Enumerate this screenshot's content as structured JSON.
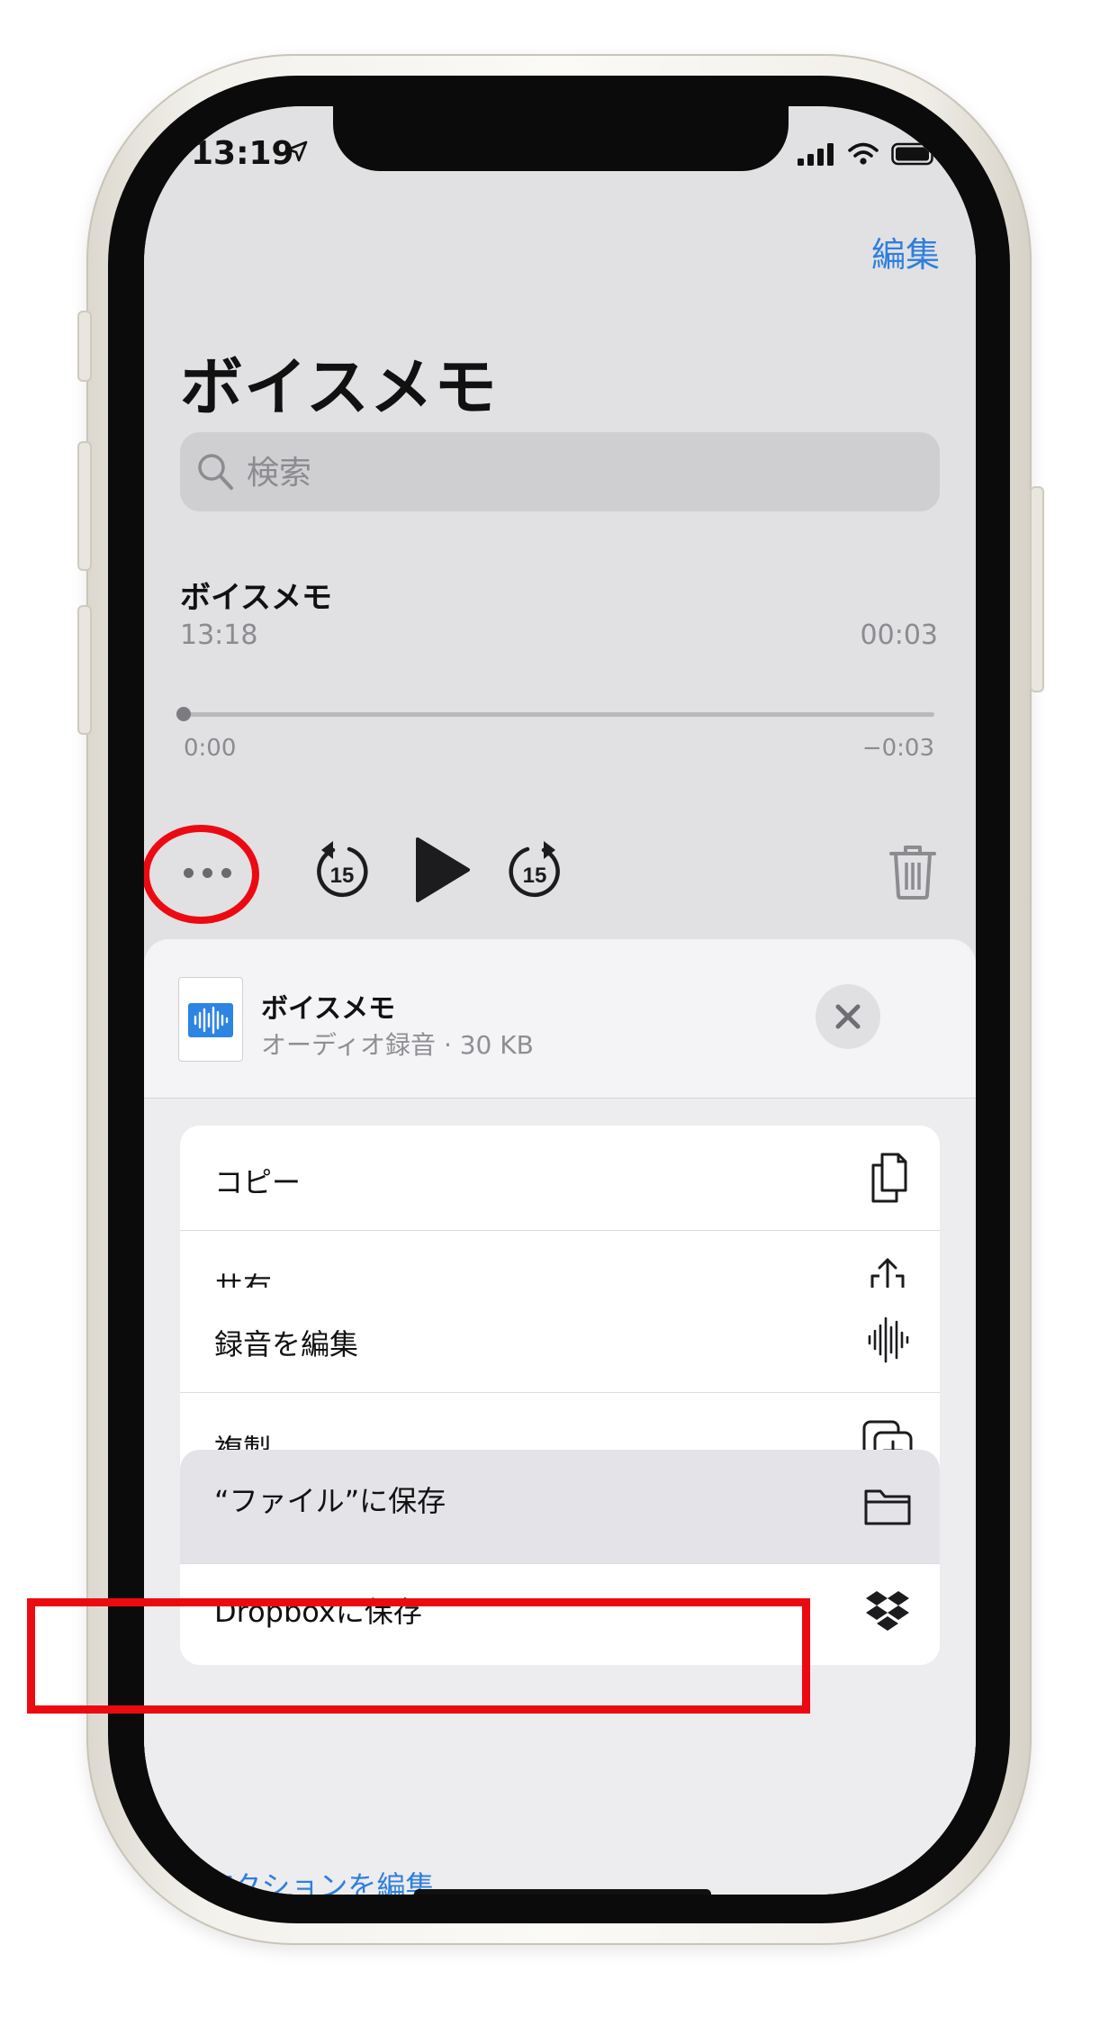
{
  "status_bar": {
    "time": "13:19"
  },
  "header": {
    "edit_label": "編集",
    "title": "ボイスメモ"
  },
  "search": {
    "placeholder": "検索"
  },
  "recording": {
    "title": "ボイスメモ",
    "date": "13:18",
    "duration": "00:03",
    "elapsed": "0:00",
    "remaining": "−0:03",
    "progress": 0
  },
  "player": {
    "skip_back_seconds": "15",
    "skip_forward_seconds": "15"
  },
  "share_sheet": {
    "file_name": "ボイスメモ",
    "file_meta": "オーディオ録音 · 30 KB",
    "groups": [
      [
        {
          "label": "コピー",
          "icon": "copy-icon"
        },
        {
          "label": "共有",
          "icon": "share-icon"
        }
      ],
      [
        {
          "label": "録音を編集",
          "icon": "waveform-icon"
        },
        {
          "label": "複製",
          "icon": "duplicate-icon"
        }
      ],
      [
        {
          "label": "“ファイル”に保存",
          "icon": "folder-icon"
        },
        {
          "label": "Dropboxに保存",
          "icon": "dropbox-icon"
        }
      ]
    ],
    "edit_actions": "アクションを編集..."
  },
  "colors": {
    "accent": "#2f7fdc",
    "annotation": "#ec0a12"
  }
}
